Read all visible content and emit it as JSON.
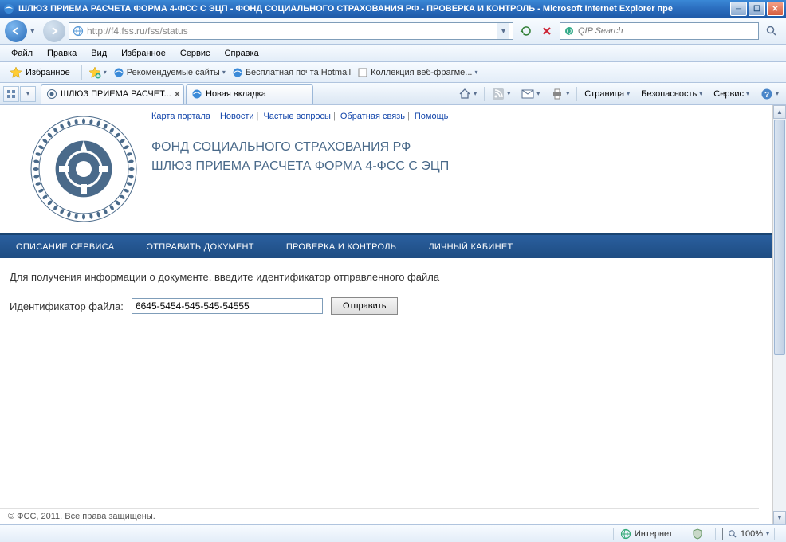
{
  "window": {
    "title": "ШЛЮЗ ПРИЕМА РАСЧЕТА ФОРМА 4-ФСС С ЭЦП - ФОНД СОЦИАЛЬНОГО СТРАХОВАНИЯ РФ - ПРОВЕРКА И КОНТРОЛЬ - Microsoft Internet Explorer пре"
  },
  "nav": {
    "url": "http://f4.fss.ru/fss/status",
    "search_placeholder": "QIP Search"
  },
  "menu": {
    "items": [
      "Файл",
      "Правка",
      "Вид",
      "Избранное",
      "Сервис",
      "Справка"
    ]
  },
  "favbar": {
    "button": "Избранное",
    "links": [
      "Рекомендуемые сайты",
      "Бесплатная почта Hotmail",
      "Коллекция веб-фрагме..."
    ]
  },
  "tabs": {
    "items": [
      {
        "label": "ШЛЮЗ ПРИЕМА РАСЧЕТ...",
        "active": true,
        "closable": true
      },
      {
        "label": "Новая вкладка",
        "active": false,
        "closable": false
      }
    ]
  },
  "right_tools": {
    "items": [
      "Страница",
      "Безопасность",
      "Сервис"
    ]
  },
  "page": {
    "top_links": [
      "Карта портала",
      "Новости",
      "Частые вопросы",
      "Обратная связь",
      "Помощь"
    ],
    "org_title": "ФОНД СОЦИАЛЬНОГО СТРАХОВАНИЯ РФ",
    "org_subtitle": "ШЛЮЗ ПРИЕМА РАСЧЕТА ФОРМА 4-ФСС С ЭЦП",
    "main_nav": [
      "ОПИСАНИЕ СЕРВИСА",
      "ОТПРАВИТЬ ДОКУМЕНТ",
      "ПРОВЕРКА И КОНТРОЛЬ",
      "ЛИЧНЫЙ КАБИНЕТ"
    ],
    "form_prompt": "Для получения информации о документе, введите идентификатор отправленного файла",
    "form_label": "Идентификатор файла:",
    "form_value": "6645-5454-545-545-54555",
    "form_button": "Отправить",
    "footer": "© ФСС, 2011. Все права защищены."
  },
  "status": {
    "zone": "Интернет",
    "zoom": "100%"
  }
}
